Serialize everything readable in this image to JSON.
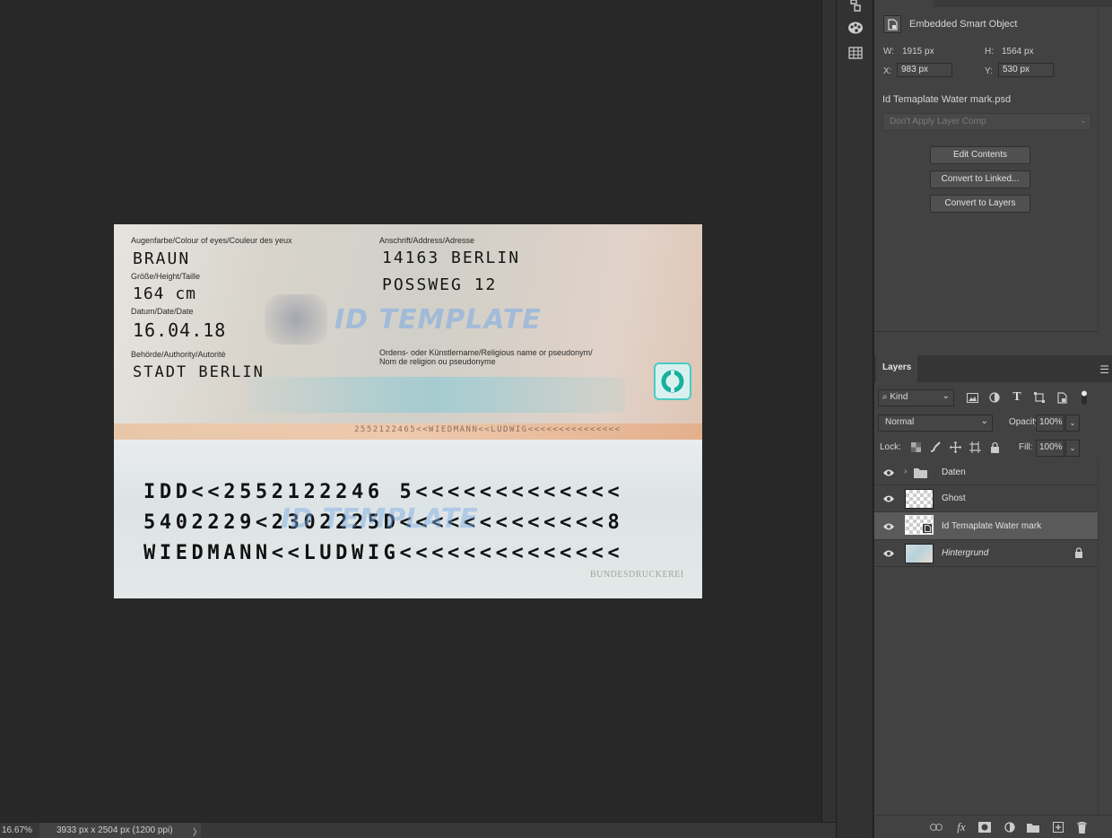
{
  "canvas": {
    "id_card": {
      "eyes_caption": "Augenfarbe/Colour of eyes/Couleur des yeux",
      "eyes_value": "BRAUN",
      "height_caption": "Größe/Height/Taille",
      "height_value": "164 cm",
      "date_caption": "Datum/Date/Date",
      "date_value": "16.04.18",
      "authority_caption": "Behörde/Authority/Autorité",
      "authority_value": "STADT BERLIN",
      "address_caption": "Anschrift/Address/Adresse",
      "address_line1": "14163 BERLIN",
      "address_line2": "POSSWEG 12",
      "pseudonym_caption1": "Ordens- oder Künstlername/Religious name or pseudonym/",
      "pseudonym_caption2": "Nom de religion ou pseudonyme",
      "watermark": "ID TEMPLATE",
      "strip_text": "2552122465<<WIEDMANN<<LUDWIG<<<<<<<<<<<<<<<",
      "mrz_line1": "IDD<<2552122246 5<<<<<<<<<<<<<",
      "mrz_line2": "5402229<2302225D<<<<<<<<<<<<<8",
      "mrz_line3": "WIEDMANN<<LUDWIG<<<<<<<<<<<<<<",
      "printer": "BUNDESDRUCKEREI"
    }
  },
  "status_bar": {
    "zoom": "16.67%",
    "doc_size": "3933 px x 2504 px (1200 ppi)",
    "arrow": "〉"
  },
  "properties": {
    "type_label": "Embedded Smart Object",
    "w_label": "W:",
    "w_value": "1915 px",
    "h_label": "H:",
    "h_value": "1564 px",
    "x_label": "X:",
    "x_value": "983 px",
    "y_label": "Y:",
    "y_value": "530 px",
    "file_name": "Id Temaplate Water mark.psd",
    "layer_comp": "Don't Apply Layer Comp",
    "edit_contents": "Edit Contents",
    "convert_linked": "Convert to Linked...",
    "convert_layers": "Convert to Layers"
  },
  "layers_panel": {
    "tab": "Layers",
    "filter": "Kind",
    "blend_mode": "Normal",
    "opacity_label": "Opacity:",
    "opacity_value": "100%",
    "lock_label": "Lock:",
    "fill_label": "Fill:",
    "fill_value": "100%",
    "layers": [
      {
        "name": "Daten",
        "type": "group"
      },
      {
        "name": "Ghost",
        "type": "pixel"
      },
      {
        "name": "Id Temaplate Water mark",
        "type": "smart-object",
        "selected": true
      },
      {
        "name": "Hintergrund",
        "type": "background",
        "locked": true
      }
    ]
  },
  "colors": {
    "canvas_bg": "#282828",
    "panel_bg": "#424242",
    "selected_layer": "#5a5a5a"
  }
}
